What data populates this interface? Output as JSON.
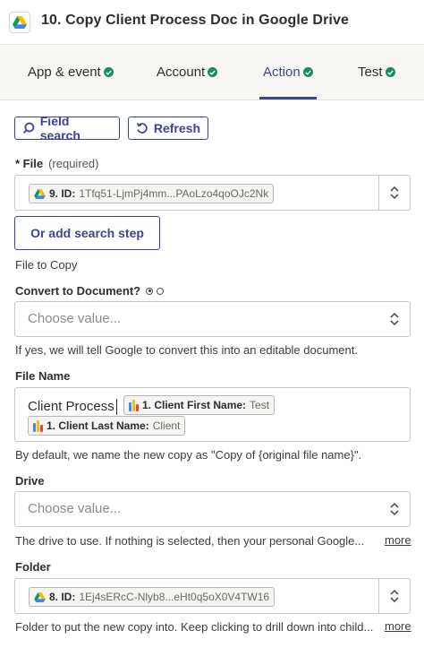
{
  "header": {
    "title": "10. Copy Client Process Doc in Google Drive",
    "app_icon": "google-drive-icon"
  },
  "tabs": [
    {
      "label": "App & event",
      "status": "complete"
    },
    {
      "label": "Account",
      "status": "complete"
    },
    {
      "label": "Action",
      "status": "complete",
      "active": true
    },
    {
      "label": "Test",
      "status": "complete"
    }
  ],
  "toolbar": {
    "field_search_label": "Field search",
    "refresh_label": "Refresh"
  },
  "file": {
    "label": "* File",
    "required_text": "(required)",
    "pill_key": "9. ID:",
    "pill_value": "1Tfq51-LjmPj4mm...PAoLzo4qoOJc2Nk",
    "search_step_label": "Or add search step",
    "help": "File to Copy"
  },
  "convert": {
    "label": "Convert to Document?",
    "placeholder": "Choose value...",
    "help": "If yes, we will tell Google to convert this into an editable document."
  },
  "file_name": {
    "label": "File Name",
    "text": "Client Process",
    "pill1_key": "1. Client First Name:",
    "pill1_value": "Test",
    "pill2_key": "1. Client Last Name:",
    "pill2_value": "Client",
    "help": "By default, we name the new copy as \"Copy of {original file name}\"."
  },
  "drive": {
    "label": "Drive",
    "placeholder": "Choose value...",
    "help": "The drive to use. If nothing is selected, then your personal Google...",
    "more_label": "more"
  },
  "folder": {
    "label": "Folder",
    "pill_key": "8. ID:",
    "pill_value": "1Ej4sERcC-Nlyb8...eHt0q5oX0V4TW16",
    "help": "Folder to put the new copy into. Keep clicking to drill down into child...",
    "more_label": "more"
  },
  "colors": {
    "accent": "#3d4592",
    "success": "#1a8f5a",
    "tab_bg": "#f7f6f3",
    "border": "#c9c8c4"
  }
}
